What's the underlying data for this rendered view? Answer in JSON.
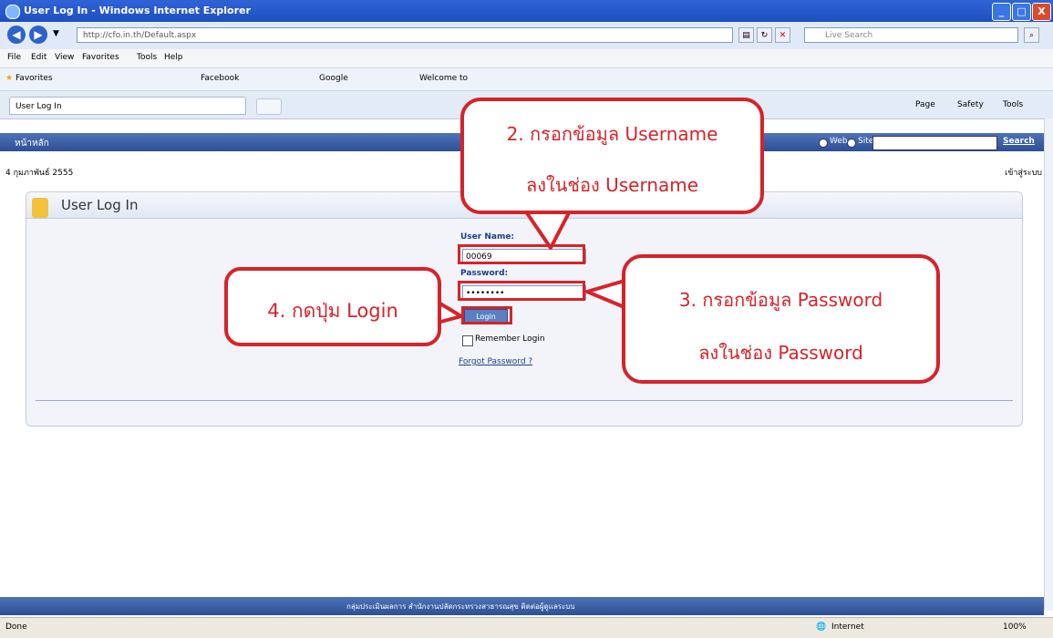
{
  "window": {
    "title": "User Log In - Windows Internet Explorer",
    "minimize": "_",
    "maximize": "□",
    "close": "X"
  },
  "address": {
    "url": "http://cfo.in.th/Default.aspx",
    "search_placeholder": "Live Search"
  },
  "menu": [
    "File",
    "Edit",
    "View",
    "Favorites",
    "Tools",
    "Help"
  ],
  "favorites": [
    "Favorites",
    "Facebook",
    "Google",
    "Welcome to"
  ],
  "tab": {
    "label": "User Log In"
  },
  "tools": [
    "Page",
    "Safety",
    "Tools"
  ],
  "page": {
    "home": "หน้าหลัก",
    "search_web": "Web",
    "search_site": "Site",
    "search_link": "Search",
    "date": "4 กุมภาพันธ์ 2555",
    "login_link": "เข้าสู่ระบบ"
  },
  "login": {
    "title": "User Log In",
    "username_label": "User Name:",
    "username_value": "00069",
    "password_label": "Password:",
    "password_value": "••••••••",
    "login_button": "Login",
    "remember": "Remember Login",
    "forgot": "Forgot Password ?"
  },
  "callouts": {
    "step2_line1": "2. กรอกข้อมูล Username",
    "step2_line2": "ลงในช่อง Username",
    "step3_line1": "3. กรอกข้อมูล Password",
    "step3_line2": "ลงในช่อง Password",
    "step4": "4. กดปุ่ม Login"
  },
  "footer": {
    "links": "กลุ่มประเมินผลการ สำนักงานปลัดกระทรวงสาธารณสุข   ติดต่อผู้ดูแลระบบ"
  },
  "status": {
    "left": "Done",
    "zone": "Internet",
    "zoom": "100%"
  },
  "colors": {
    "accent_red": "#d6232a",
    "header_blue": "#2d4f95",
    "title_blue": "#1f4fc0"
  }
}
